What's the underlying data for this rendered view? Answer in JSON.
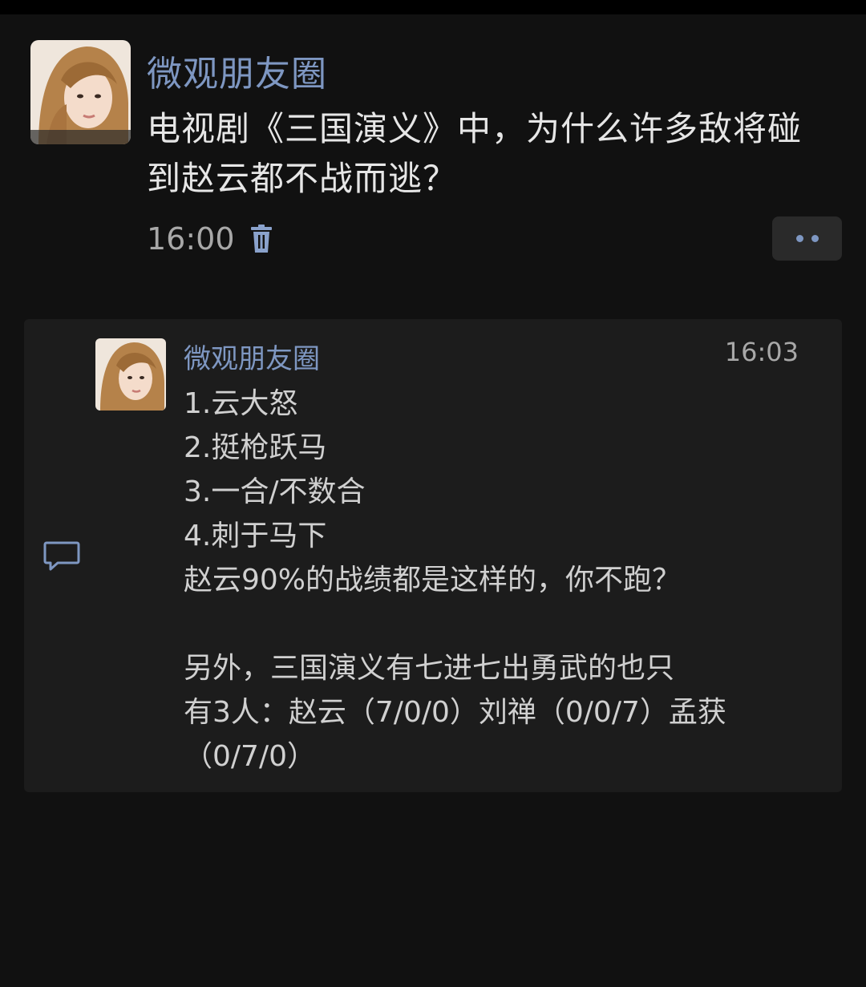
{
  "post": {
    "author": "微观朋友圈",
    "text_lines": [
      "电视剧《三国演义》中，为什么许多敌将碰",
      "到赵云都不战而逃？"
    ],
    "time": "16:00"
  },
  "comment": {
    "author": "微观朋友圈",
    "time": "16:03",
    "lines": [
      "1.云大怒",
      "2.挺枪跃马",
      "3.一合/不数合",
      "4.刺于马下",
      "赵云90%的战绩都是这样的，你不跑？",
      "",
      "另外，三国演义有七进七出勇武的也只",
      "有3人：赵云（7/0/0）刘禅（0/0/7）孟获",
      "（0/7/0）"
    ]
  },
  "icons": {
    "delete": "trash-icon",
    "more": "more-icon",
    "comment": "comment-icon"
  },
  "colors": {
    "background": "#111111",
    "panel": "#1c1c1c",
    "name": "#7e97c2",
    "text": "#e6e6e6",
    "muted": "#a8a8a8"
  }
}
